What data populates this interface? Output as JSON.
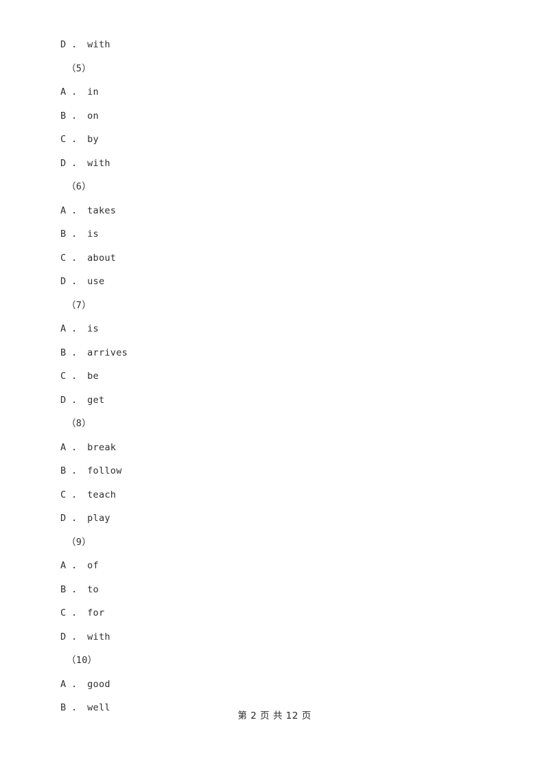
{
  "document": {
    "page_label": "第 2 页 共 12 页",
    "current_page": "2",
    "total_pages": "12",
    "text_color": "#2f2f2f",
    "background_color": "#ffffff"
  },
  "lines": [
    {
      "kind": "option",
      "text": "D ． with"
    },
    {
      "kind": "group-num",
      "text": "（5）"
    },
    {
      "kind": "option",
      "text": "A ． in"
    },
    {
      "kind": "option",
      "text": "B ． on"
    },
    {
      "kind": "option",
      "text": "C ． by"
    },
    {
      "kind": "option",
      "text": "D ． with"
    },
    {
      "kind": "group-num",
      "text": "（6）"
    },
    {
      "kind": "option",
      "text": "A ． takes"
    },
    {
      "kind": "option",
      "text": "B ． is"
    },
    {
      "kind": "option",
      "text": "C ． about"
    },
    {
      "kind": "option",
      "text": "D ． use"
    },
    {
      "kind": "group-num",
      "text": "（7）"
    },
    {
      "kind": "option",
      "text": "A ． is"
    },
    {
      "kind": "option",
      "text": "B ． arrives"
    },
    {
      "kind": "option",
      "text": "C ． be"
    },
    {
      "kind": "option",
      "text": "D ． get"
    },
    {
      "kind": "group-num",
      "text": "（8）"
    },
    {
      "kind": "option",
      "text": "A ． break"
    },
    {
      "kind": "option",
      "text": "B ． follow"
    },
    {
      "kind": "option",
      "text": "C ． teach"
    },
    {
      "kind": "option",
      "text": "D ． play"
    },
    {
      "kind": "group-num",
      "text": "（9）"
    },
    {
      "kind": "option",
      "text": "A ． of"
    },
    {
      "kind": "option",
      "text": "B ． to"
    },
    {
      "kind": "option",
      "text": "C ． for"
    },
    {
      "kind": "option",
      "text": "D ． with"
    },
    {
      "kind": "group-num",
      "text": "（10）"
    },
    {
      "kind": "option",
      "text": "A ． good"
    },
    {
      "kind": "option",
      "text": "B ． well"
    }
  ]
}
